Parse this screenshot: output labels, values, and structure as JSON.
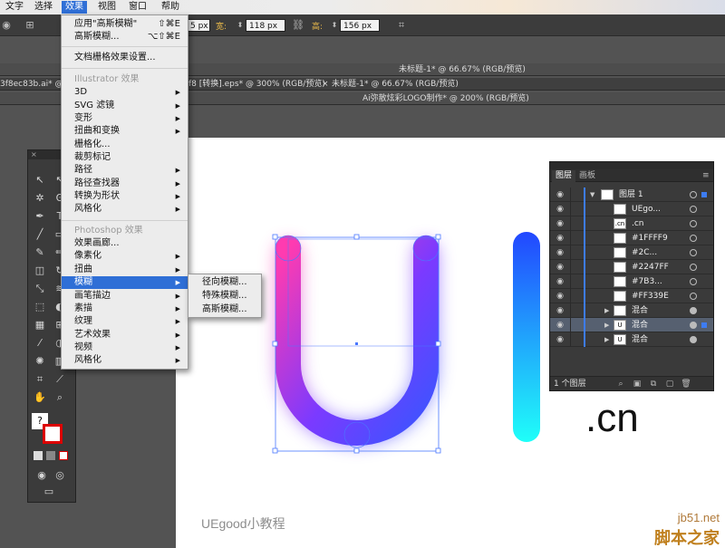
{
  "menubar": {
    "items": [
      "文字",
      "选择",
      "效果",
      "视图",
      "窗口",
      "帮助"
    ],
    "active_index": 2
  },
  "controlbar": {
    "x_value": "5 px",
    "w_label": "宽:",
    "w_value": "118 px",
    "h_label": "高:",
    "h_value": "156 px"
  },
  "docs": {
    "row2_title": "未标题-1* @ 66.67% (RGB/预览)",
    "row3_tabs": [
      "3f8ec83b.ai* @ 3",
      "f8 [转换].eps* @ 300% (RGB/预览)",
      "未标题-1* @ 66.67% (RGB/预览)"
    ],
    "row3_close": "×",
    "row4_title": "Ai弥散炫彩LOGO制作* @ 200% (RGB/预览)"
  },
  "effect_menu": {
    "apply_last": "应用\"高斯模糊\"",
    "apply_last_shortcut": "⇧⌘E",
    "last_effect": "高斯模糊...",
    "last_effect_shortcut": "⌥⇧⌘E",
    "raster_settings": "文档栅格效果设置...",
    "illustrator_header": "Illustrator 效果",
    "illustrator_items": [
      "3D",
      "SVG 滤镜",
      "变形",
      "扭曲和变换",
      "栅格化...",
      "裁剪标记",
      "路径",
      "路径查找器",
      "转换为形状",
      "风格化"
    ],
    "photoshop_header": "Photoshop 效果",
    "photoshop_items": [
      "效果画廊...",
      "像素化",
      "扭曲",
      "模糊",
      "画笔描边",
      "素描",
      "纹理",
      "艺术效果",
      "视频",
      "风格化"
    ]
  },
  "blur_submenu": {
    "items": [
      "径向模糊...",
      "特殊模糊...",
      "高斯模糊..."
    ]
  },
  "canvas": {
    "watermark": "UEgood小教程",
    "cn_text": ".cn",
    "gradient_u": {
      "top_left": "#ff3bb0",
      "bottom": "#7b3aff",
      "right": "#3a55ff"
    },
    "gradient_bar": {
      "top": "#2247ff",
      "bottom": "#1ffff9"
    }
  },
  "layers_panel": {
    "tabs": [
      "图层",
      "画板"
    ],
    "layers": [
      {
        "name": "图层 1",
        "thumb": ""
      },
      {
        "name": "UEgo...",
        "thumb": ""
      },
      {
        "name": ".cn",
        "thumb": ".cn"
      },
      {
        "name": "#1FFFF9",
        "thumb": ""
      },
      {
        "name": "#2C...",
        "thumb": ""
      },
      {
        "name": "#2247FF",
        "thumb": ""
      },
      {
        "name": "#7B3...",
        "thumb": ""
      },
      {
        "name": "#FF339E",
        "thumb": ""
      },
      {
        "name": "混合",
        "thumb": ""
      },
      {
        "name": "混合",
        "thumb": "U"
      },
      {
        "name": "混合",
        "thumb": "U"
      }
    ],
    "footer_count": "1 个图层"
  },
  "site_watermark": {
    "url": "jb51.net",
    "name": "脚本之家"
  }
}
